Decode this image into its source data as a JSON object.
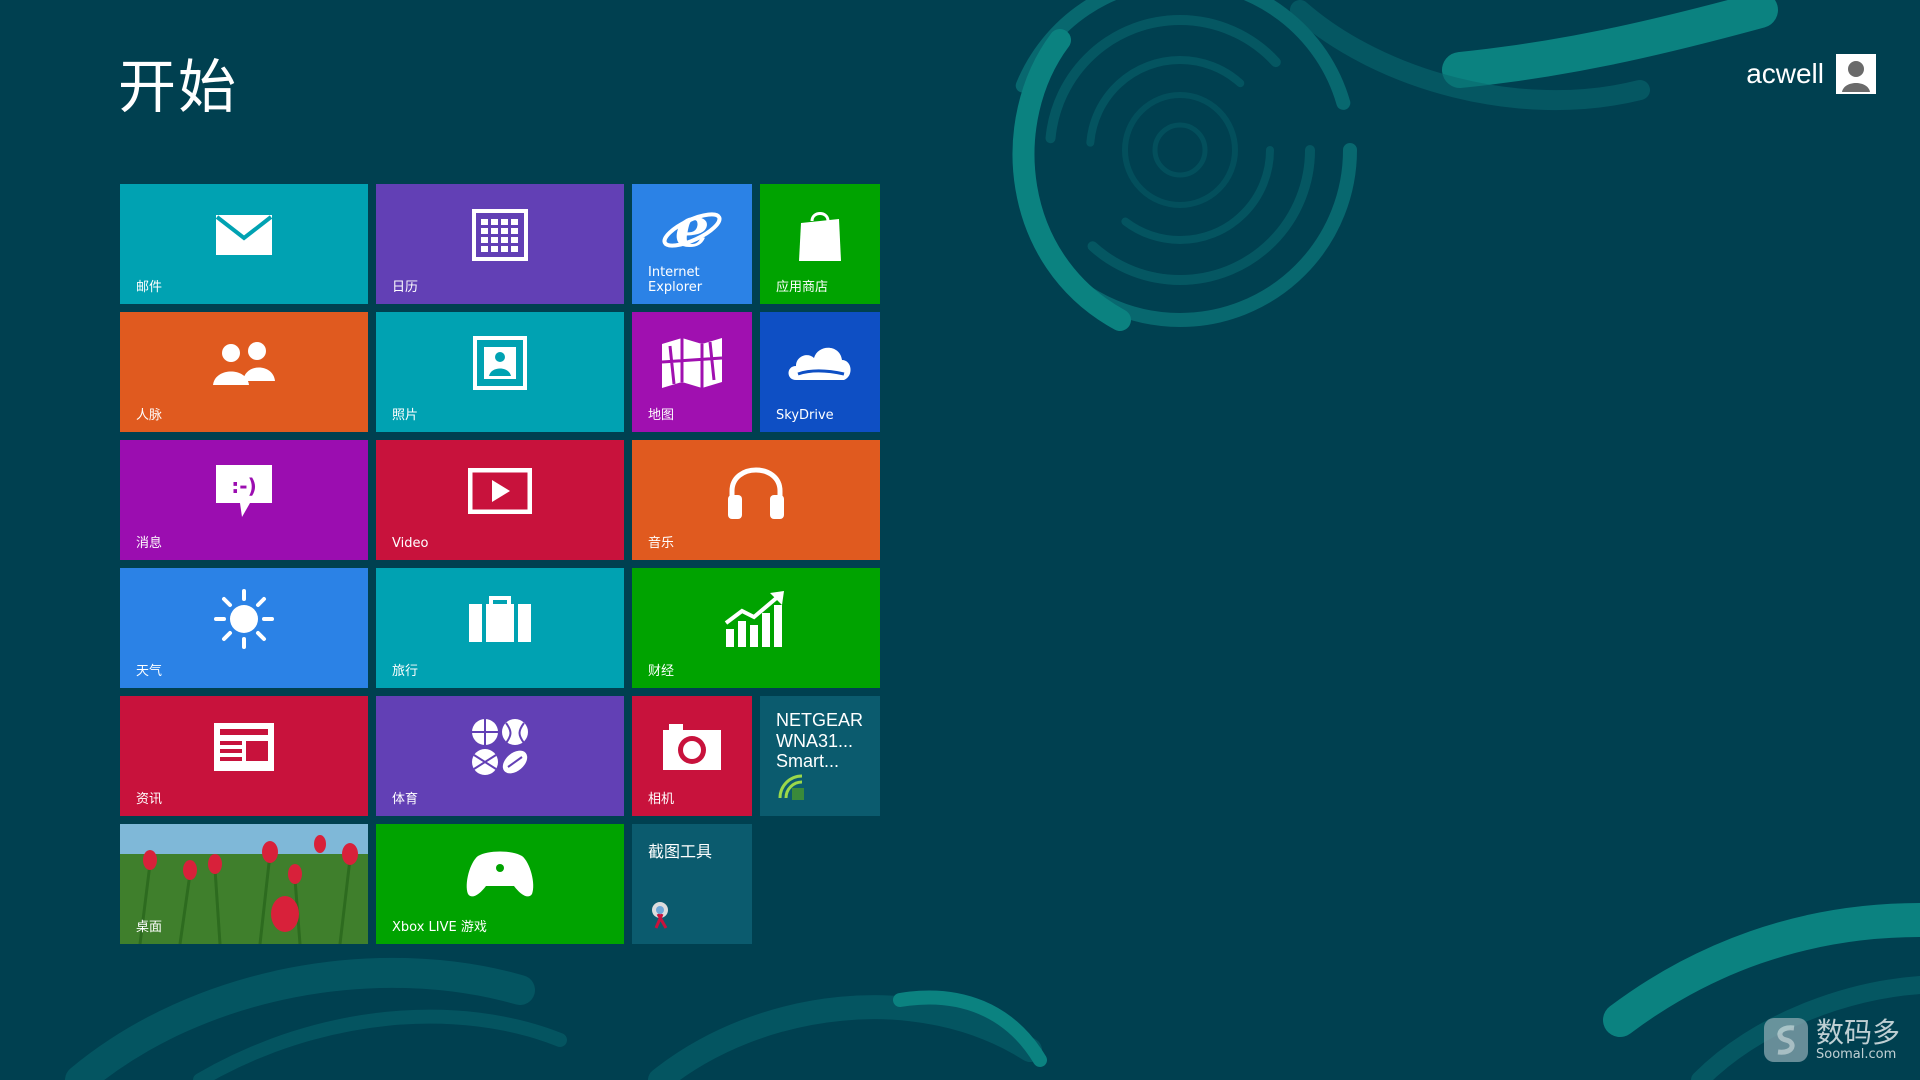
{
  "title": "开始",
  "user": {
    "name": "acwell",
    "icon": "user-icon"
  },
  "colors": {
    "background": "#004050",
    "accent_swirl": "#0b8c8a"
  },
  "tiles": [
    {
      "label": "邮件",
      "icon": "mail-icon",
      "color": "#00a2b2"
    },
    {
      "label": "日历",
      "icon": "calendar-icon",
      "color": "#6240b5"
    },
    {
      "label_line1": "Internet",
      "label_line2": "Explorer",
      "icon": "ie-icon",
      "color": "#2b82e6"
    },
    {
      "label": "应用商店",
      "icon": "store-icon",
      "color": "#00a300"
    },
    {
      "label": "人脉",
      "icon": "people-icon",
      "color": "#e05a1f"
    },
    {
      "label": "照片",
      "icon": "photos-icon",
      "color": "#00a2b2"
    },
    {
      "label": "地图",
      "icon": "maps-icon",
      "color": "#a010b0"
    },
    {
      "label": "SkyDrive",
      "icon": "skydrive-icon",
      "color": "#0e4fc4"
    },
    {
      "label": "消息",
      "icon": "messaging-icon",
      "color": "#9b0db0"
    },
    {
      "label": "Video",
      "icon": "video-icon",
      "color": "#c8123c"
    },
    {
      "label": "音乐",
      "icon": "headphones-icon",
      "color": "#e05a1f"
    },
    {
      "label": "天气",
      "icon": "sun-icon",
      "color": "#2b82e6"
    },
    {
      "label": "旅行",
      "icon": "suitcase-icon",
      "color": "#00a2b2"
    },
    {
      "label": "财经",
      "icon": "chart-icon",
      "color": "#00a300"
    },
    {
      "label": "资讯",
      "icon": "news-icon",
      "color": "#c8123c"
    },
    {
      "label": "体育",
      "icon": "sports-icon",
      "color": "#6240b5"
    },
    {
      "label": "相机",
      "icon": "camera-icon",
      "color": "#c8123c"
    },
    {
      "line1": "NETGEAR",
      "line2": "WNA31...",
      "line3": "Smart...",
      "icon": "wireless-icon",
      "color": "#0b5b6e"
    },
    {
      "label": "桌面",
      "icon": "desktop-wallpaper",
      "color": "#4f8a3a"
    },
    {
      "label": "Xbox LIVE 游戏",
      "icon": "gamepad-icon",
      "color": "#00a300"
    },
    {
      "label": "截图工具",
      "icon": "scissors-icon",
      "color": "#0b5b6e"
    }
  ],
  "watermark": {
    "cn": "数码多",
    "en": "Soomal.com"
  }
}
